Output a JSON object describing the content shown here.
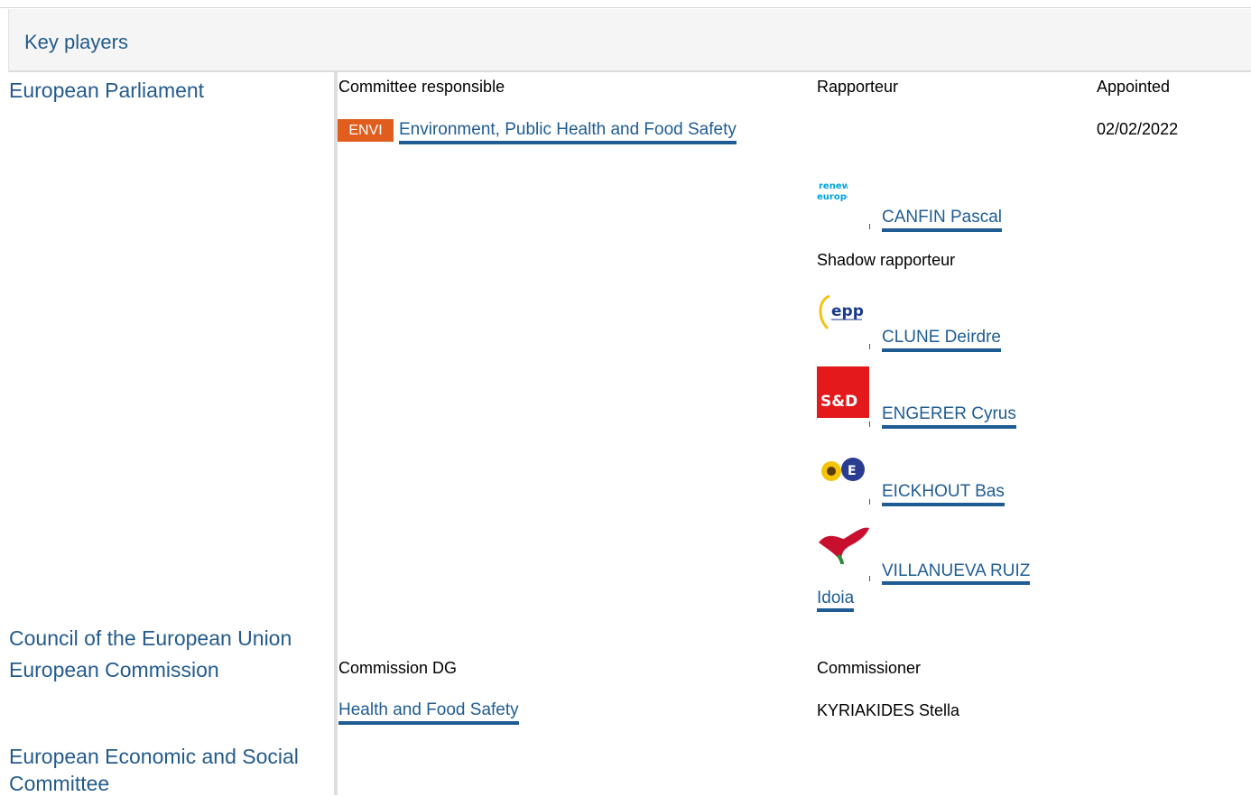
{
  "section": {
    "title": "Key players"
  },
  "institutions": {
    "parliament": "European Parliament",
    "council": "Council of the European Union",
    "commission": "European Commission",
    "eesc": "European Economic and Social Committee"
  },
  "parliament": {
    "committee_header": "Committee responsible",
    "rapporteur_header": "Rapporteur",
    "appointed_header": "Appointed",
    "committee": {
      "badge": "ENVI",
      "badge_color": "#e05d1e",
      "name": "Environment, Public Health and Food Safety",
      "appointed": "02/02/2022"
    },
    "rapporteur": {
      "logo": "renew-europe-logo",
      "name": "CANFIN Pascal"
    },
    "shadow_header": "Shadow rapporteur",
    "shadows": [
      {
        "logo": "epp-logo",
        "name": "CLUNE Deirdre"
      },
      {
        "logo": "sd-logo",
        "name": "ENGERER Cyrus"
      },
      {
        "logo": "greens-efa-logo",
        "name": "EICKHOUT Bas"
      },
      {
        "logo": "left-logo",
        "name": "VILLANUEVA RUIZ Idoia"
      }
    ]
  },
  "commission": {
    "dg_header": "Commission DG",
    "commissioner_header": "Commissioner",
    "dg": "Health and Food Safety",
    "commissioner": "KYRIAKIDES Stella"
  },
  "logos": {
    "renew_text": "renew europe.",
    "epp_text": "epp",
    "sd_text": "S&D"
  },
  "colors": {
    "link": "#1f5c93",
    "institution": "#245b8c",
    "header_bg": "#f5f5f5",
    "sd_red": "#e3191b",
    "renew_blue": "#00a3e0"
  }
}
